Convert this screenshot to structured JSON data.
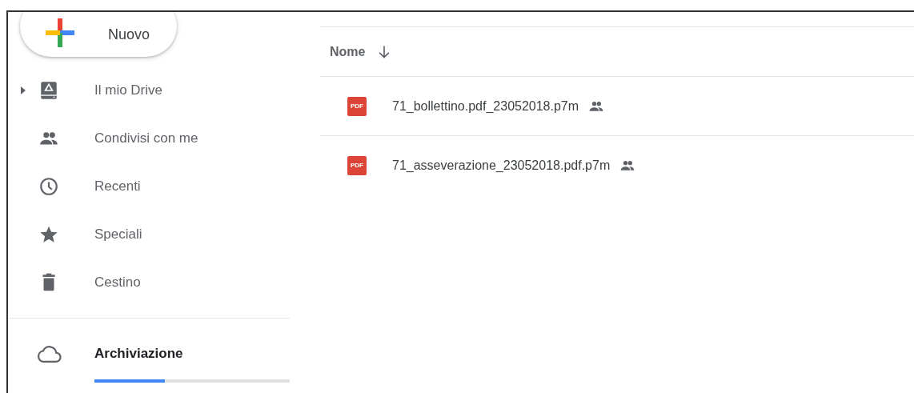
{
  "new_button": {
    "label": "Nuovo"
  },
  "sidebar": {
    "items": [
      {
        "label": "Il mio Drive",
        "kind": "drive",
        "expanded": false
      },
      {
        "label": "Condivisi con me",
        "kind": "shared"
      },
      {
        "label": "Recenti",
        "kind": "recent"
      },
      {
        "label": "Speciali",
        "kind": "starred"
      },
      {
        "label": "Cestino",
        "kind": "trash"
      }
    ],
    "storage": {
      "label": "Archiviazione",
      "level": 0.36
    }
  },
  "file_list": {
    "columns": [
      {
        "label": "Nome",
        "sort_descending": true
      }
    ],
    "rows": [
      {
        "name": "71_bollettino.pdf_23052018.p7m",
        "type_label": "PDF",
        "shared": true
      },
      {
        "name": "71_asseverazione_23052018.pdf.p7m",
        "type_label": "PDF",
        "shared": true
      }
    ]
  }
}
